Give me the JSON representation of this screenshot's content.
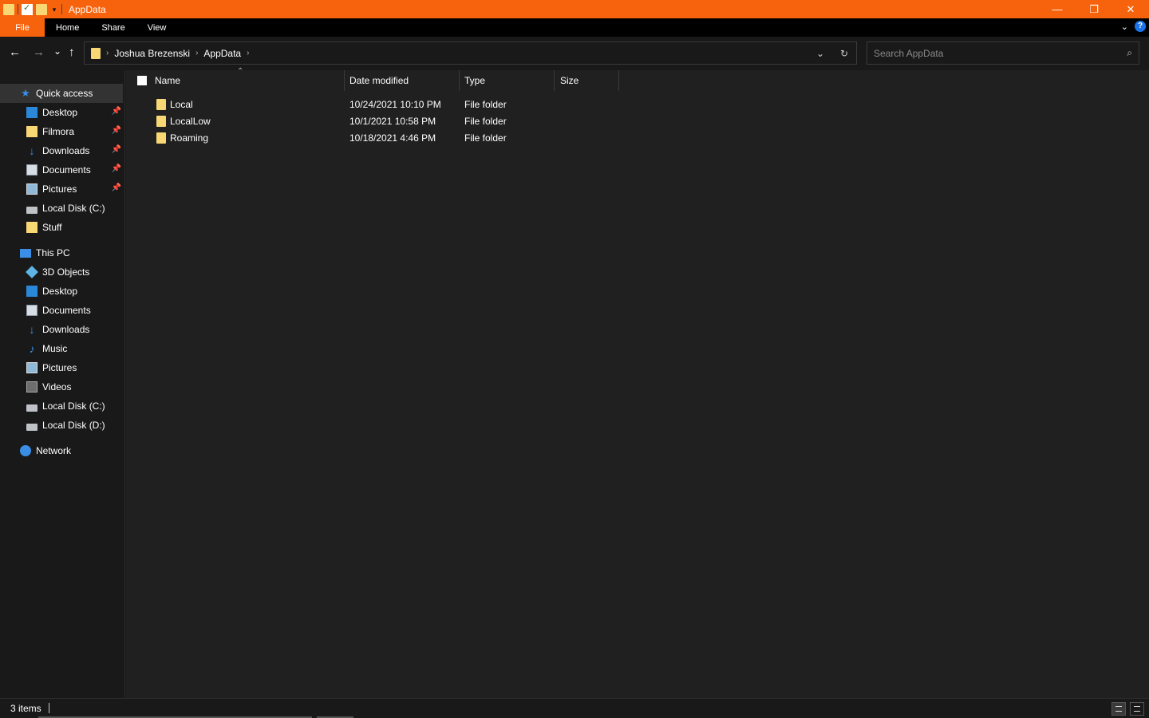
{
  "window": {
    "title": "AppData",
    "titlebar_color": "#f7630c",
    "controls": {
      "minimize": "—",
      "restore": "❐",
      "close": "✕"
    }
  },
  "ribbon": {
    "tabs": [
      "File",
      "Home",
      "Share",
      "View"
    ],
    "help": "?"
  },
  "nav": {
    "back": "←",
    "forward": "→",
    "recent": "⌄",
    "up": "↑",
    "breadcrumb": [
      "Joshua Brezenski",
      "AppData"
    ],
    "dropdown_icon": "chevron-down-icon",
    "refresh": "↻"
  },
  "search": {
    "placeholder": "Search AppData",
    "icon": "search-icon"
  },
  "sidebar": {
    "quick_access": {
      "label": "Quick access",
      "items": [
        {
          "label": "Desktop",
          "icon": "desktop-icon",
          "pinned": true
        },
        {
          "label": "Filmora",
          "icon": "folder-icon",
          "pinned": true
        },
        {
          "label": "Downloads",
          "icon": "downloads-icon",
          "pinned": true
        },
        {
          "label": "Documents",
          "icon": "documents-icon",
          "pinned": true
        },
        {
          "label": "Pictures",
          "icon": "pictures-icon",
          "pinned": true
        },
        {
          "label": "Local Disk (C:)",
          "icon": "disk-icon",
          "pinned": false
        },
        {
          "label": "Stuff",
          "icon": "folder-icon",
          "pinned": false
        }
      ]
    },
    "this_pc": {
      "label": "This PC",
      "items": [
        {
          "label": "3D Objects",
          "icon": "3d-objects-icon"
        },
        {
          "label": "Desktop",
          "icon": "desktop-icon"
        },
        {
          "label": "Documents",
          "icon": "documents-icon"
        },
        {
          "label": "Downloads",
          "icon": "downloads-icon"
        },
        {
          "label": "Music",
          "icon": "music-icon"
        },
        {
          "label": "Pictures",
          "icon": "pictures-icon"
        },
        {
          "label": "Videos",
          "icon": "videos-icon"
        },
        {
          "label": "Local Disk (C:)",
          "icon": "disk-icon"
        },
        {
          "label": "Local Disk (D:)",
          "icon": "disk-icon"
        }
      ]
    },
    "network": {
      "label": "Network"
    },
    "pin_glyph": "📌"
  },
  "columns": {
    "name": "Name",
    "date": "Date modified",
    "type": "Type",
    "size": "Size"
  },
  "files": [
    {
      "name": "Local",
      "date": "10/24/2021 10:10 PM",
      "type": "File folder",
      "size": ""
    },
    {
      "name": "LocalLow",
      "date": "10/1/2021 10:58 PM",
      "type": "File folder",
      "size": ""
    },
    {
      "name": "Roaming",
      "date": "10/18/2021 4:46 PM",
      "type": "File folder",
      "size": ""
    }
  ],
  "status": {
    "item_count": "3 items"
  }
}
